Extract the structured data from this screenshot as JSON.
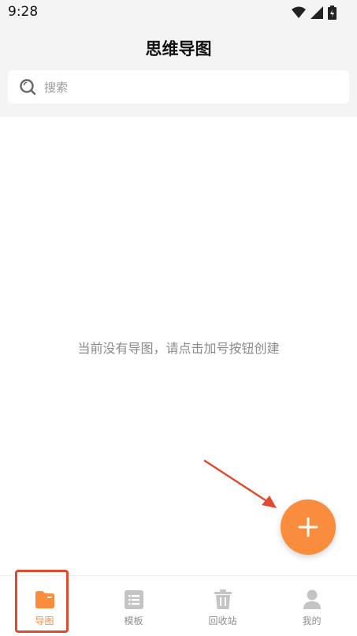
{
  "status": {
    "time": "9:28",
    "icons": [
      "wifi-icon",
      "signal-icon",
      "battery-icon"
    ]
  },
  "header": {
    "title": "思维导图"
  },
  "search": {
    "placeholder": "搜索",
    "icon": "search-icon"
  },
  "empty_state": {
    "message": "当前没有导图，请点击加号按钮创建"
  },
  "fab": {
    "icon": "plus-icon",
    "color": "#f98c3d"
  },
  "annotation": {
    "arrow_color": "#e04a2f",
    "highlight_color": "#e04a2f"
  },
  "nav": {
    "items": [
      {
        "label": "导图",
        "icon": "folder-icon",
        "active": true
      },
      {
        "label": "模板",
        "icon": "template-icon",
        "active": false
      },
      {
        "label": "回收站",
        "icon": "trash-icon",
        "active": false
      },
      {
        "label": "我的",
        "icon": "user-icon",
        "active": false
      }
    ],
    "active_color": "#f98c3d",
    "inactive_color": "#c4c4c4"
  }
}
